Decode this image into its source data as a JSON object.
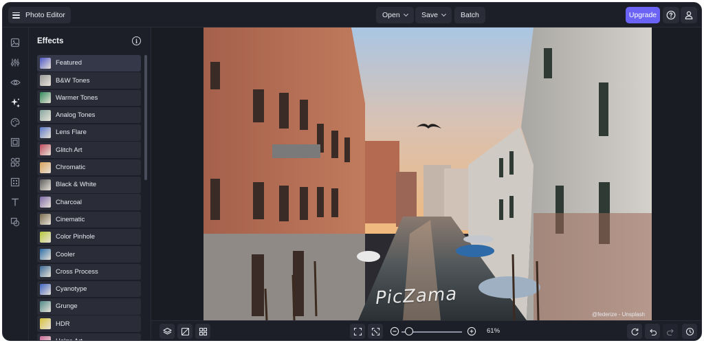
{
  "header": {
    "app_title": "Photo Editor",
    "open_label": "Open",
    "save_label": "Save",
    "batch_label": "Batch",
    "upgrade_label": "Upgrade",
    "help_icon": "question-circle-icon",
    "account_icon": "user-icon"
  },
  "rail": {
    "icons": [
      "image-icon",
      "sliders-icon",
      "eye-icon",
      "effects-sparkle-icon",
      "palette-icon",
      "frame-icon",
      "overlays-grid-icon",
      "texture-icon",
      "text-icon",
      "graphics-icon"
    ]
  },
  "effects_panel": {
    "title": "Effects",
    "items": [
      {
        "label": "Featured",
        "color": "#4b58c7"
      },
      {
        "label": "B&W Tones",
        "color": "#9a9a9a"
      },
      {
        "label": "Warmer Tones",
        "color": "#2f8a5a"
      },
      {
        "label": "Analog Tones",
        "color": "#86a7a0"
      },
      {
        "label": "Lens Flare",
        "color": "#5a78c8"
      },
      {
        "label": "Glitch Art",
        "color": "#c04a5c"
      },
      {
        "label": "Chromatic",
        "color": "#d9a35a"
      },
      {
        "label": "Black & White",
        "color": "#5c5c5c"
      },
      {
        "label": "Charcoal",
        "color": "#7d6aa8"
      },
      {
        "label": "Cinematic",
        "color": "#7a6b4e"
      },
      {
        "label": "Color Pinhole",
        "color": "#b7c83a"
      },
      {
        "label": "Cooler",
        "color": "#2d6ea8"
      },
      {
        "label": "Cross Process",
        "color": "#3a6a98"
      },
      {
        "label": "Cyanotype",
        "color": "#3d63c2"
      },
      {
        "label": "Grunge",
        "color": "#4e8a88"
      },
      {
        "label": "HDR",
        "color": "#d7c23c"
      },
      {
        "label": "Holga Art",
        "color": "#c96a98"
      }
    ]
  },
  "canvas": {
    "photo_credit": "@federize - Unsplash",
    "watermark": "PicZama"
  },
  "bottom_bar": {
    "zoom_label": "61%",
    "zoom_level": 0.12,
    "left_icons": [
      "layers-icon",
      "compare-icon",
      "grid-icon"
    ],
    "center_icons": [
      "fit-screen-icon",
      "actual-size-icon",
      "zoom-out-icon",
      "zoom-in-icon"
    ],
    "right_icons": [
      "reset-icon",
      "undo-icon",
      "redo-icon",
      "history-icon"
    ]
  }
}
